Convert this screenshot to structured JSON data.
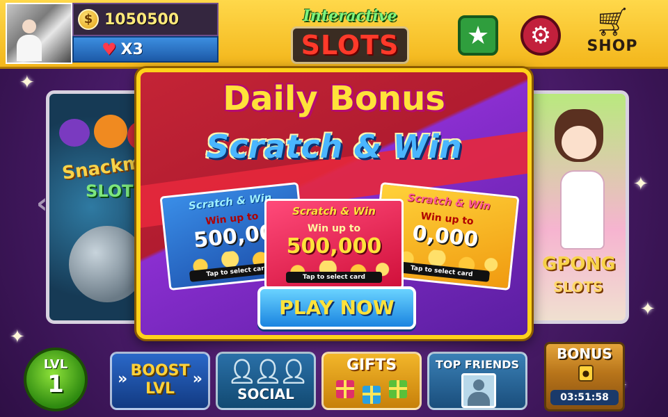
{
  "header": {
    "coins": "1050500",
    "coin_symbol": "$",
    "lives": "X3",
    "logo_top": "Interactive",
    "logo_bottom": "SLOTS",
    "shop_label": "SHOP"
  },
  "carousel": {
    "left_game": {
      "title_1": "Snackm",
      "title_2": "SLOTS"
    },
    "right_game": {
      "title_1": "GPONG",
      "title_2": "SLOTS"
    }
  },
  "modal": {
    "title_1": "Daily Bonus",
    "title_2": "Scratch & Win",
    "cards": [
      {
        "color": "blue",
        "header": "Scratch & Win",
        "win_text": "Win up to",
        "amount": "500,00",
        "tap_text": "Tap to select card"
      },
      {
        "color": "red",
        "header": "Scratch & Win",
        "win_text": "Win up to",
        "amount": "500,000",
        "tap_text": "Tap to select card"
      },
      {
        "color": "yellow",
        "header": "Scratch & Win",
        "win_text": "Win up to",
        "amount": "0,000",
        "tap_text": "Tap to select card"
      }
    ],
    "play_button": "PLAY NOW"
  },
  "bottom": {
    "level_label": "LVL",
    "level_value": "1",
    "boost_label_1": "BOOST",
    "boost_label_2": "LVL",
    "social_label": "SOCIAL",
    "gifts_label": "GIFTS",
    "friends_label": "TOP FRIENDS",
    "bonus_label": "BONUS",
    "bonus_timer": "03:51:58"
  },
  "colors": {
    "accent_gold": "#ffd21a",
    "play_blue": "#1a84e0",
    "brand_red": "#ff3a2a",
    "level_green": "#2e8a10"
  },
  "icons": [
    "coin-icon",
    "heart-icon",
    "star-icon",
    "gear-icon",
    "cart-icon",
    "people-icon",
    "gift-icon",
    "person-icon",
    "lock-icon",
    "chevron-left-icon"
  ]
}
